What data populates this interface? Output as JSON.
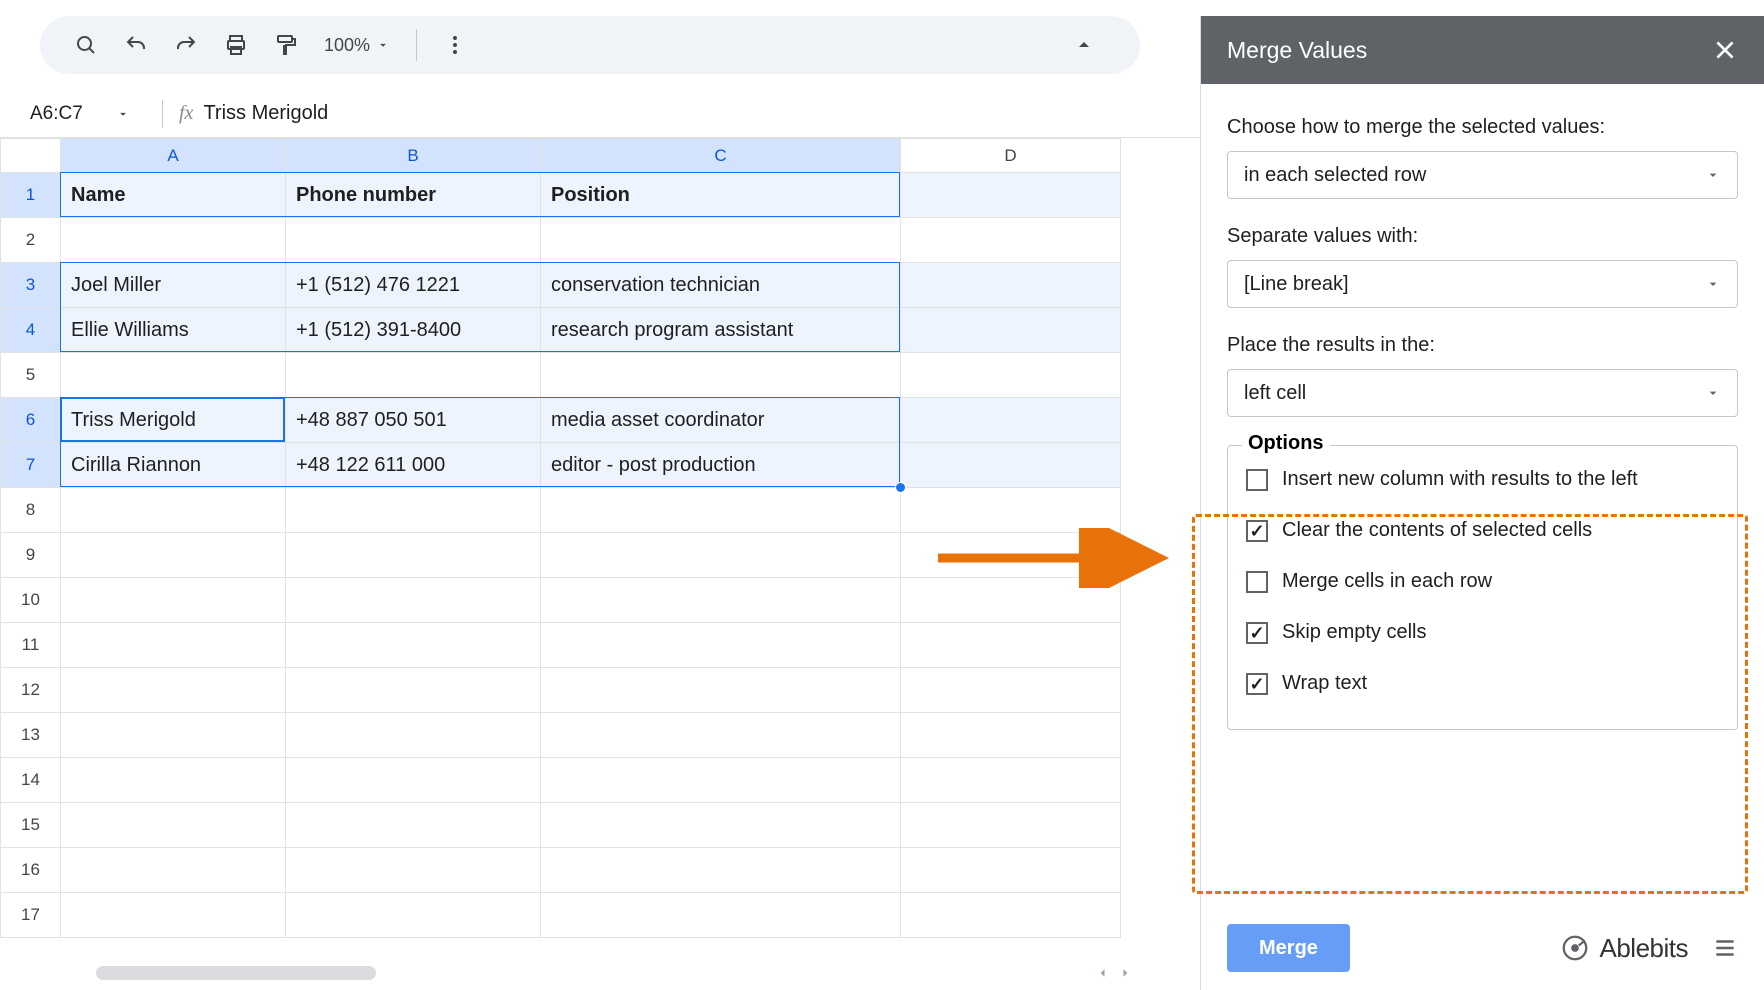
{
  "toolbar": {
    "zoom": "100%"
  },
  "formula_bar": {
    "cell_ref": "A6:C7",
    "formula": "Triss Merigold"
  },
  "columns": [
    "A",
    "B",
    "C",
    "D"
  ],
  "selected_cols": [
    "A",
    "B",
    "C"
  ],
  "row_count": 17,
  "selected_rows": [
    1,
    3,
    4,
    6,
    7
  ],
  "headers": {
    "a": "Name",
    "b": "Phone number",
    "c": "Position"
  },
  "rows": {
    "3": {
      "a": "Joel Miller",
      "b": "+1 (512) 476 1221",
      "c": "conservation technician"
    },
    "4": {
      "a": "Ellie Williams",
      "b": "+1 (512) 391-8400",
      "c": "research program assistant"
    },
    "6": {
      "a": "Triss Merigold",
      "b": "+48 887 050 501",
      "c": "media asset coordinator"
    },
    "7": {
      "a": "Cirilla Riannon",
      "b": "+48 122 611 000",
      "c": "editor - post production"
    }
  },
  "sidebar": {
    "title": "Merge Values",
    "label_how": "Choose how to merge the selected values:",
    "how_value": "in each selected row",
    "label_sep": "Separate values with:",
    "sep_value": "[Line break]",
    "label_place": "Place the results in the:",
    "place_value": "left cell",
    "options_legend": "Options",
    "opt1": "Insert new column with results to the left",
    "opt2": "Clear the contents of selected cells",
    "opt3": "Merge cells in each row",
    "opt4": "Skip empty cells",
    "opt5": "Wrap text",
    "merge_btn": "Merge",
    "brand": "Ablebits"
  }
}
